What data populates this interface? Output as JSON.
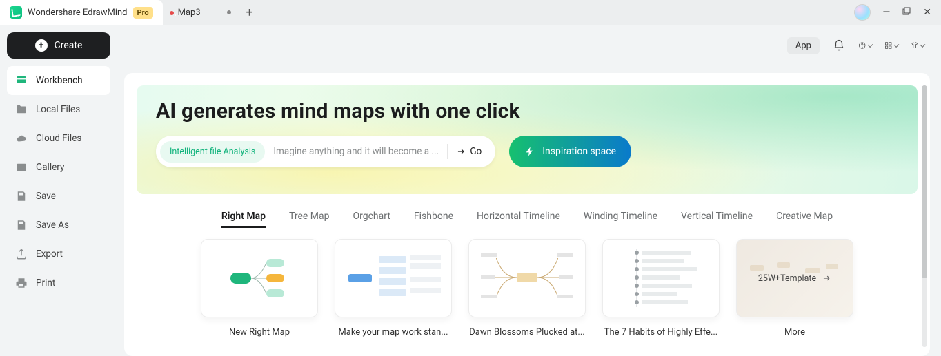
{
  "titlebar": {
    "app_name": "Wondershare EdrawMind",
    "pro_badge": "Pro",
    "doc_tab": "Map3"
  },
  "toolbar": {
    "create": "Create",
    "app_btn": "App"
  },
  "sidebar": {
    "items": [
      {
        "label": "Workbench"
      },
      {
        "label": "Local Files"
      },
      {
        "label": "Cloud Files"
      },
      {
        "label": "Gallery"
      },
      {
        "label": "Save"
      },
      {
        "label": "Save As"
      },
      {
        "label": "Export"
      },
      {
        "label": "Print"
      }
    ]
  },
  "hero": {
    "title": "AI generates mind maps with one click",
    "chip": "Intelligent file Analysis",
    "placeholder": "Imagine anything and it will become a ...",
    "go": "Go",
    "inspiration": "Inspiration space"
  },
  "tabs": [
    "Right Map",
    "Tree Map",
    "Orgchart",
    "Fishbone",
    "Horizontal Timeline",
    "Winding Timeline",
    "Vertical Timeline",
    "Creative Map"
  ],
  "cards": [
    {
      "label": "New Right Map"
    },
    {
      "label": "Make your map work stan..."
    },
    {
      "label": "Dawn Blossoms Plucked at..."
    },
    {
      "label": "The 7 Habits of Highly Effe..."
    },
    {
      "label": "More"
    }
  ],
  "more_thumb_text": "25W+Template"
}
